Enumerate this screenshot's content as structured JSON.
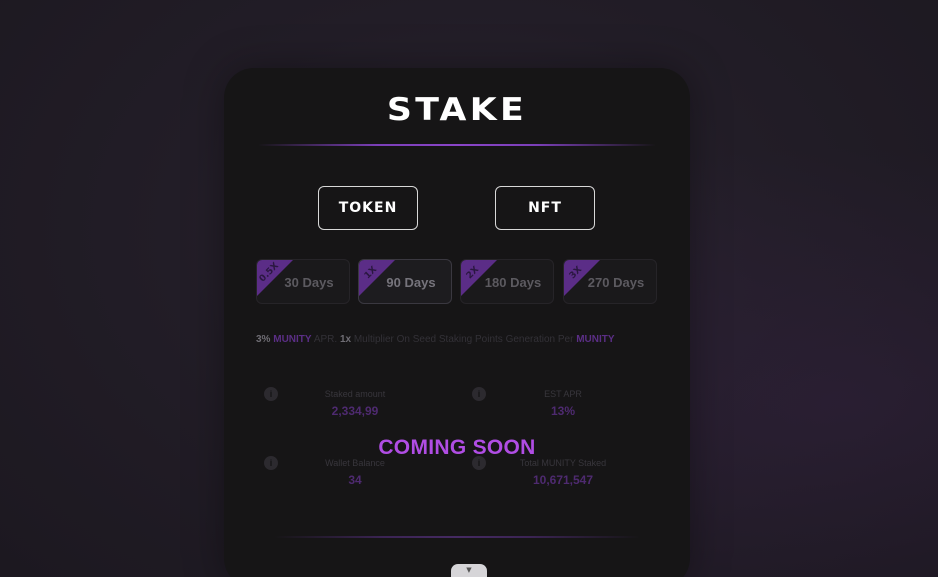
{
  "title": "STAKE",
  "tabs": [
    {
      "label": "TOKEN"
    },
    {
      "label": "NFT"
    }
  ],
  "periods": [
    {
      "multiplier": "0.5X",
      "label": "30 Days"
    },
    {
      "multiplier": "1X",
      "label": "90 Days"
    },
    {
      "multiplier": "2X",
      "label": "180 Days"
    },
    {
      "multiplier": "3X",
      "label": "270 Days"
    }
  ],
  "apr_line": {
    "pct": "3%",
    "token": "MUNITY",
    "apr": "APR.",
    "mult": "1x",
    "text": "Multiplier On Seed Staking Points Generation Per",
    "token2": "MUNITY"
  },
  "stats": {
    "staked": {
      "label": "Staked amount",
      "value": "2,334,99"
    },
    "est_apr": {
      "label": "EST APR",
      "value": "13%"
    },
    "wallet": {
      "label": "Wallet Balance",
      "value": "34"
    },
    "total": {
      "label": "Total MUNITY Staked",
      "value": "10,671,547"
    }
  },
  "overlay": "COMING SOON",
  "icons": {
    "info": "info-icon",
    "expand": "chevron-down-icon"
  },
  "colors": {
    "accent": "#b04de4",
    "card": "#161516",
    "background": "#221d27"
  }
}
